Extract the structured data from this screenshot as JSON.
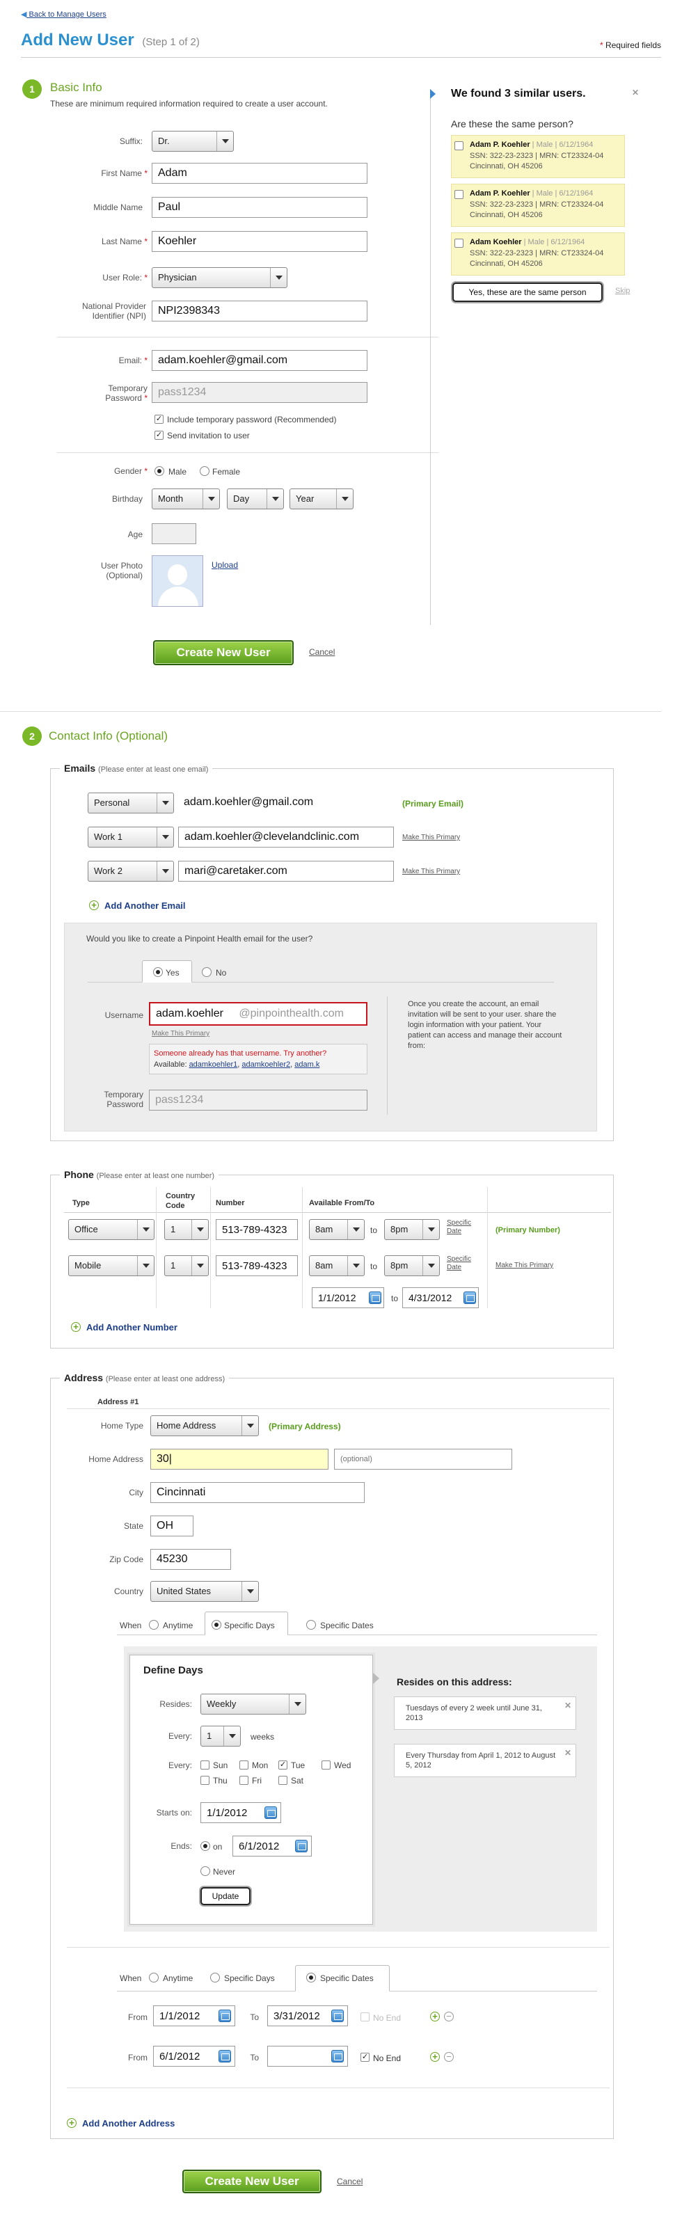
{
  "nav": {
    "back_link": "Back to Manage Users"
  },
  "header": {
    "title": "Add New User",
    "step": "(Step 1 of 2)",
    "required_note": "Required fields"
  },
  "basic": {
    "num": "1",
    "title": "Basic Info",
    "desc": "These are minimum required information required to create a user account.",
    "suffix_label": "Suffix:",
    "suffix_value": "Dr.",
    "first_label": "First Name",
    "first_value": "Adam",
    "middle_label": "Middle Name",
    "middle_value": "Paul",
    "last_label": "Last Name",
    "last_value": "Koehler",
    "role_label": "User Role:",
    "role_value": "Physician",
    "npi_label": "National Provider Identifier (NPI)",
    "npi_value": "NPI2398343",
    "email_label": "Email:",
    "email_value": "adam.koehler@gmail.com",
    "temp_label": "Temporary Password",
    "temp_value": "pass1234",
    "include_temp": "Include temporary password (Recommended)",
    "send_invite": "Send invitation to user",
    "gender_label": "Gender",
    "gender_male": "Male",
    "gender_female": "Female",
    "birthday_label": "Birthday",
    "month": "Month",
    "day": "Day",
    "year": "Year",
    "age_label": "Age",
    "photo_label": "User Photo (Optional)",
    "upload": "Upload",
    "create_btn": "Create New User",
    "cancel": "Cancel"
  },
  "similar": {
    "title": "We found 3 similar users.",
    "question": "Are these the same person?",
    "people": [
      {
        "name": "Adam P. Koehler",
        "meta": "| Male | 6/12/1964",
        "ids": "SSN: 322-23-2323 | MRN: CT23324-04",
        "addr": "Cincinnati, OH 45206"
      },
      {
        "name": "Adam P. Koehler",
        "meta": "| Male | 6/12/1964",
        "ids": "SSN: 322-23-2323 | MRN: CT23324-04",
        "addr": "Cincinnati, OH 45206"
      },
      {
        "name": "Adam Koehler",
        "meta": "| Male | 6/12/1964",
        "ids": "SSN: 322-23-2323 | MRN: CT23324-04",
        "addr": "Cincinnati, OH 45206"
      }
    ],
    "same_btn": "Yes, these are the same person",
    "skip": "Skip"
  },
  "contact": {
    "num": "2",
    "title": "Contact Info (Optional)"
  },
  "emails": {
    "title": "Emails",
    "hint": "(Please enter at least one email)",
    "rows": [
      {
        "type": "Personal",
        "value": "adam.koehler@gmail.com",
        "status": "(Primary Email)"
      },
      {
        "type": "Work 1",
        "value": "adam.koehler@clevelandclinic.com",
        "status": "Make This Primary"
      },
      {
        "type": "Work 2",
        "value": "mari@caretaker.com",
        "status": "Make This Primary"
      }
    ],
    "add": "Add Another Email",
    "pp_question": "Would you like to create a Pinpoint Health email for the user?",
    "yes": "Yes",
    "no": "No",
    "username_label": "Username",
    "username_value": "adam.koehler",
    "domain": "@pinpointhealth.com",
    "make_primary": "Make This Primary",
    "taken": "Someone already has that username. Try another?",
    "available": "Available:",
    "suggestions": [
      "adamkoehler1",
      "adamkoehler2",
      "adam.k"
    ],
    "temp_label": "Temporary Password",
    "temp_value": "pass1234",
    "info": "Once you create the account, an email invitation will be sent to your user. share the login information with your patient. Your patient can access and manage their account from:"
  },
  "phone": {
    "title": "Phone",
    "hint": "(Please enter at least one number)",
    "headers": {
      "type": "Type",
      "country": "Country Code",
      "number": "Number",
      "avail": "Available From/To"
    },
    "rows": [
      {
        "type": "Office",
        "cc": "1",
        "number": "513-789-4323",
        "from": "8am",
        "to": "8pm",
        "specific": "Specific Date",
        "status": "(Primary Number)"
      },
      {
        "type": "Mobile",
        "cc": "1",
        "number": "513-789-4323",
        "from": "8am",
        "to": "8pm",
        "specific": "Specific Date",
        "status": "Make This Primary"
      }
    ],
    "to": "to",
    "date_from": "1/1/2012",
    "date_to": "4/31/2012",
    "add": "Add Another Number"
  },
  "address": {
    "title": "Address",
    "hint": "(Please enter at least one address)",
    "heading": "Address #1",
    "home_type_label": "Home Type",
    "home_type_value": "Home Address",
    "primary": "(Primary Address)",
    "home_addr_label": "Home Address",
    "home_addr_value": "30|",
    "optional": "(optional)",
    "city_label": "City",
    "city": "Cincinnati",
    "state_label": "State",
    "state": "OH",
    "zip_label": "Zip Code",
    "zip": "45230",
    "country_label": "Country",
    "country": "United States",
    "when": "When",
    "anytime": "Anytime",
    "specific_days": "Specific Days",
    "specific_dates": "Specific Dates",
    "define_title": "Define Days",
    "resides_label": "Resides:",
    "resides_value": "Weekly",
    "every_label": "Every:",
    "every_value": "1",
    "weeks": "weeks",
    "days": [
      "Sun",
      "Mon",
      "Tue",
      "Wed",
      "Thu",
      "Fri",
      "Sat"
    ],
    "starts_label": "Starts on:",
    "starts_value": "1/1/2012",
    "ends_label": "Ends:",
    "on": "on",
    "ends_value": "6/1/2012",
    "never": "Never",
    "update": "Update",
    "resides_title": "Resides on this address:",
    "resides_items": [
      "Tuesdays of every 2 week until June 31, 2013",
      "Every Thursday from April 1, 2012 to August 5, 2012"
    ],
    "from_label": "From",
    "to_label": "To",
    "no_end": "No End",
    "date_rows": [
      {
        "from": "1/1/2012",
        "to": "3/31/2012"
      },
      {
        "from": "6/1/2012",
        "to": ""
      }
    ],
    "add": "Add Another Address"
  },
  "footer": {
    "create_btn": "Create New User",
    "cancel": "Cancel"
  }
}
